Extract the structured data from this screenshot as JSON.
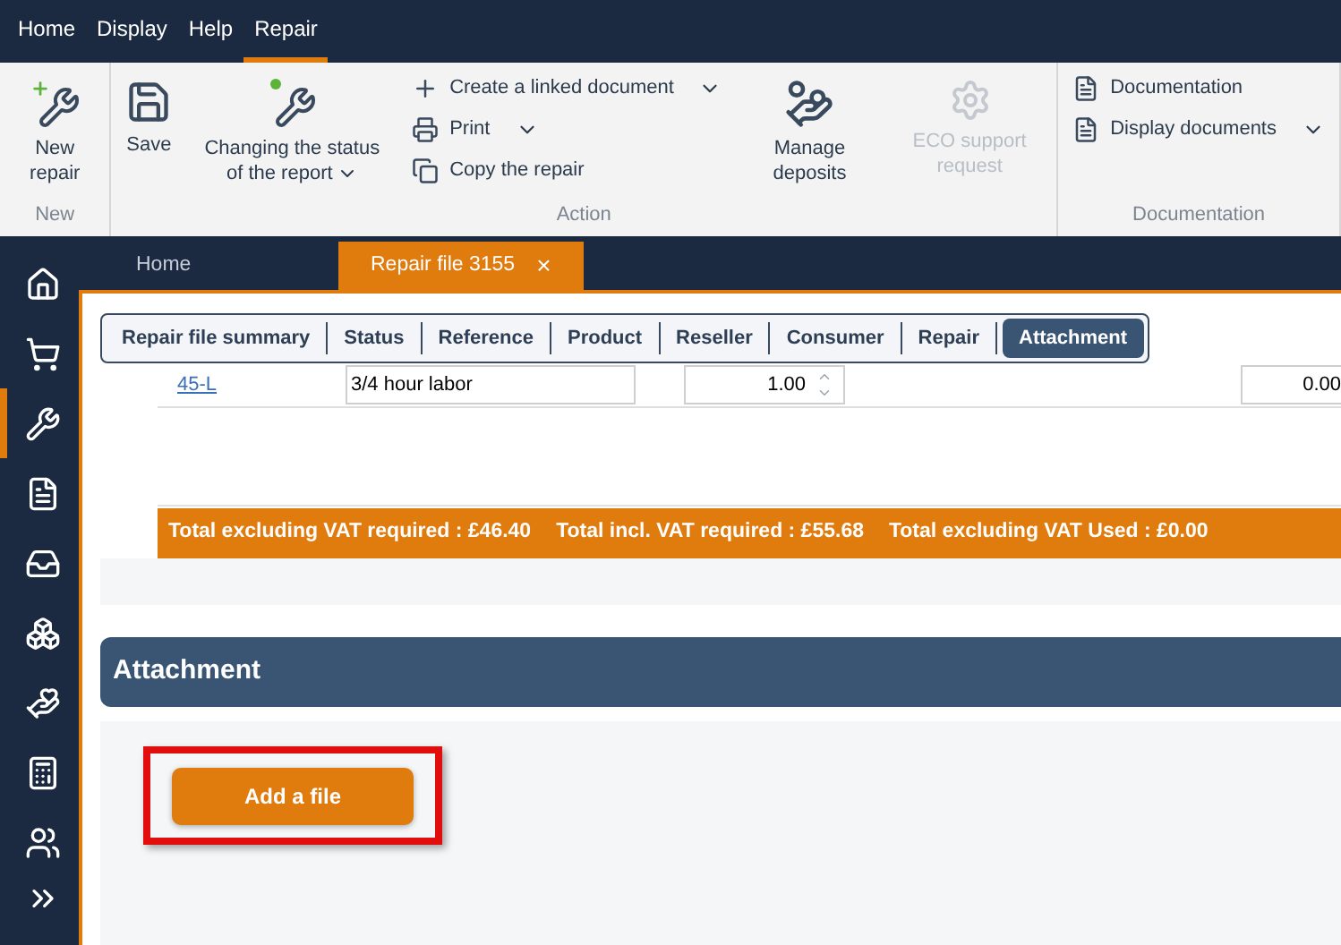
{
  "menu": [
    {
      "label": "Home",
      "selected": false
    },
    {
      "label": "Display",
      "selected": false
    },
    {
      "label": "Help",
      "selected": false
    },
    {
      "label": "Repair",
      "selected": true
    }
  ],
  "ribbon": {
    "groups": [
      {
        "title": "New",
        "items": [
          {
            "kind": "large",
            "label": "New repair",
            "disabled": false,
            "dropdown": false
          }
        ]
      },
      {
        "title": "Action",
        "items": [
          {
            "kind": "large",
            "label": "Save",
            "disabled": false,
            "dropdown": false
          },
          {
            "kind": "large",
            "label": "Changing the status of the report",
            "dropdown": true,
            "disabled": false
          },
          {
            "kind": "stack",
            "entries": [
              {
                "label": "Create a linked document",
                "dropdown": true
              },
              {
                "label": "Print",
                "dropdown": true
              },
              {
                "label": "Copy the repair",
                "dropdown": false
              }
            ]
          },
          {
            "kind": "large",
            "label": "Manage deposits",
            "disabled": false,
            "dropdown": false
          },
          {
            "kind": "large",
            "label": "ECO support request",
            "disabled": true,
            "dropdown": false
          }
        ]
      },
      {
        "title": "Documentation",
        "items": [
          {
            "kind": "stack",
            "entries": [
              {
                "label": "Documentation",
                "dropdown": false
              },
              {
                "label": "Display documents",
                "dropdown": true
              }
            ]
          }
        ]
      }
    ]
  },
  "sidebar": [
    {
      "selected": false
    },
    {
      "selected": false
    },
    {
      "selected": true
    },
    {
      "selected": false
    },
    {
      "selected": false
    },
    {
      "selected": false
    },
    {
      "selected": false
    },
    {
      "selected": false
    },
    {
      "selected": false
    },
    {
      "selected": false
    }
  ],
  "doc_tabs": [
    {
      "label": "Home",
      "selected": false
    },
    {
      "label": "Repair file 3155",
      "selected": true,
      "close": "×"
    }
  ],
  "section_tabs": [
    {
      "label": "Repair file summary",
      "selected": false
    },
    {
      "label": "Status",
      "selected": false
    },
    {
      "label": "Reference",
      "selected": false
    },
    {
      "label": "Product",
      "selected": false
    },
    {
      "label": "Reseller",
      "selected": false
    },
    {
      "label": "Consumer",
      "selected": false
    },
    {
      "label": "Repair",
      "selected": false
    },
    {
      "label": "Attachment",
      "selected": true
    }
  ],
  "line": {
    "code": "45-L",
    "description": "3/4 hour labor",
    "quantity": "1.00",
    "amount": "0.00"
  },
  "totals": [
    "Total excluding VAT required : £46.40",
    "Total incl. VAT required : £55.68",
    "Total excluding VAT Used : £0.00"
  ],
  "attachment": {
    "title": "Attachment",
    "button": "Add a file"
  }
}
